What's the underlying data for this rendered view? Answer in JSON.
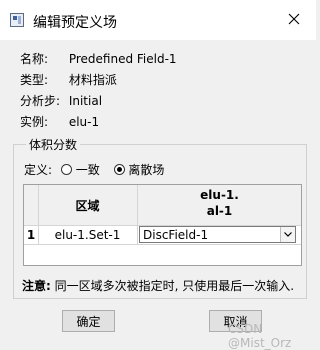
{
  "window": {
    "title": "编辑预定义场"
  },
  "info": [
    {
      "label": "名称:",
      "value": "Predefined Field-1"
    },
    {
      "label": "类型:",
      "value": "材料指派"
    },
    {
      "label": "分析步:",
      "value": "Initial"
    },
    {
      "label": "实例:",
      "value": "elu-1"
    }
  ],
  "volume_fraction": {
    "group_title": "体积分数",
    "definition_label": "定义:",
    "options": [
      {
        "label": "一致",
        "selected": false
      },
      {
        "label": "离散场",
        "selected": true
      }
    ]
  },
  "table": {
    "headers": [
      "区域",
      "elu-1.\nal-1"
    ],
    "rows": [
      {
        "index": "1",
        "region": "elu-1.Set-1",
        "value": "DiscField-1"
      }
    ]
  },
  "note": {
    "prefix": "注意:",
    "text": "同一区域多次被指定时, 只使用最后一次输入."
  },
  "buttons": {
    "ok": "确定",
    "cancel": "取消"
  },
  "watermark": "CSDN @Mist_Orz"
}
